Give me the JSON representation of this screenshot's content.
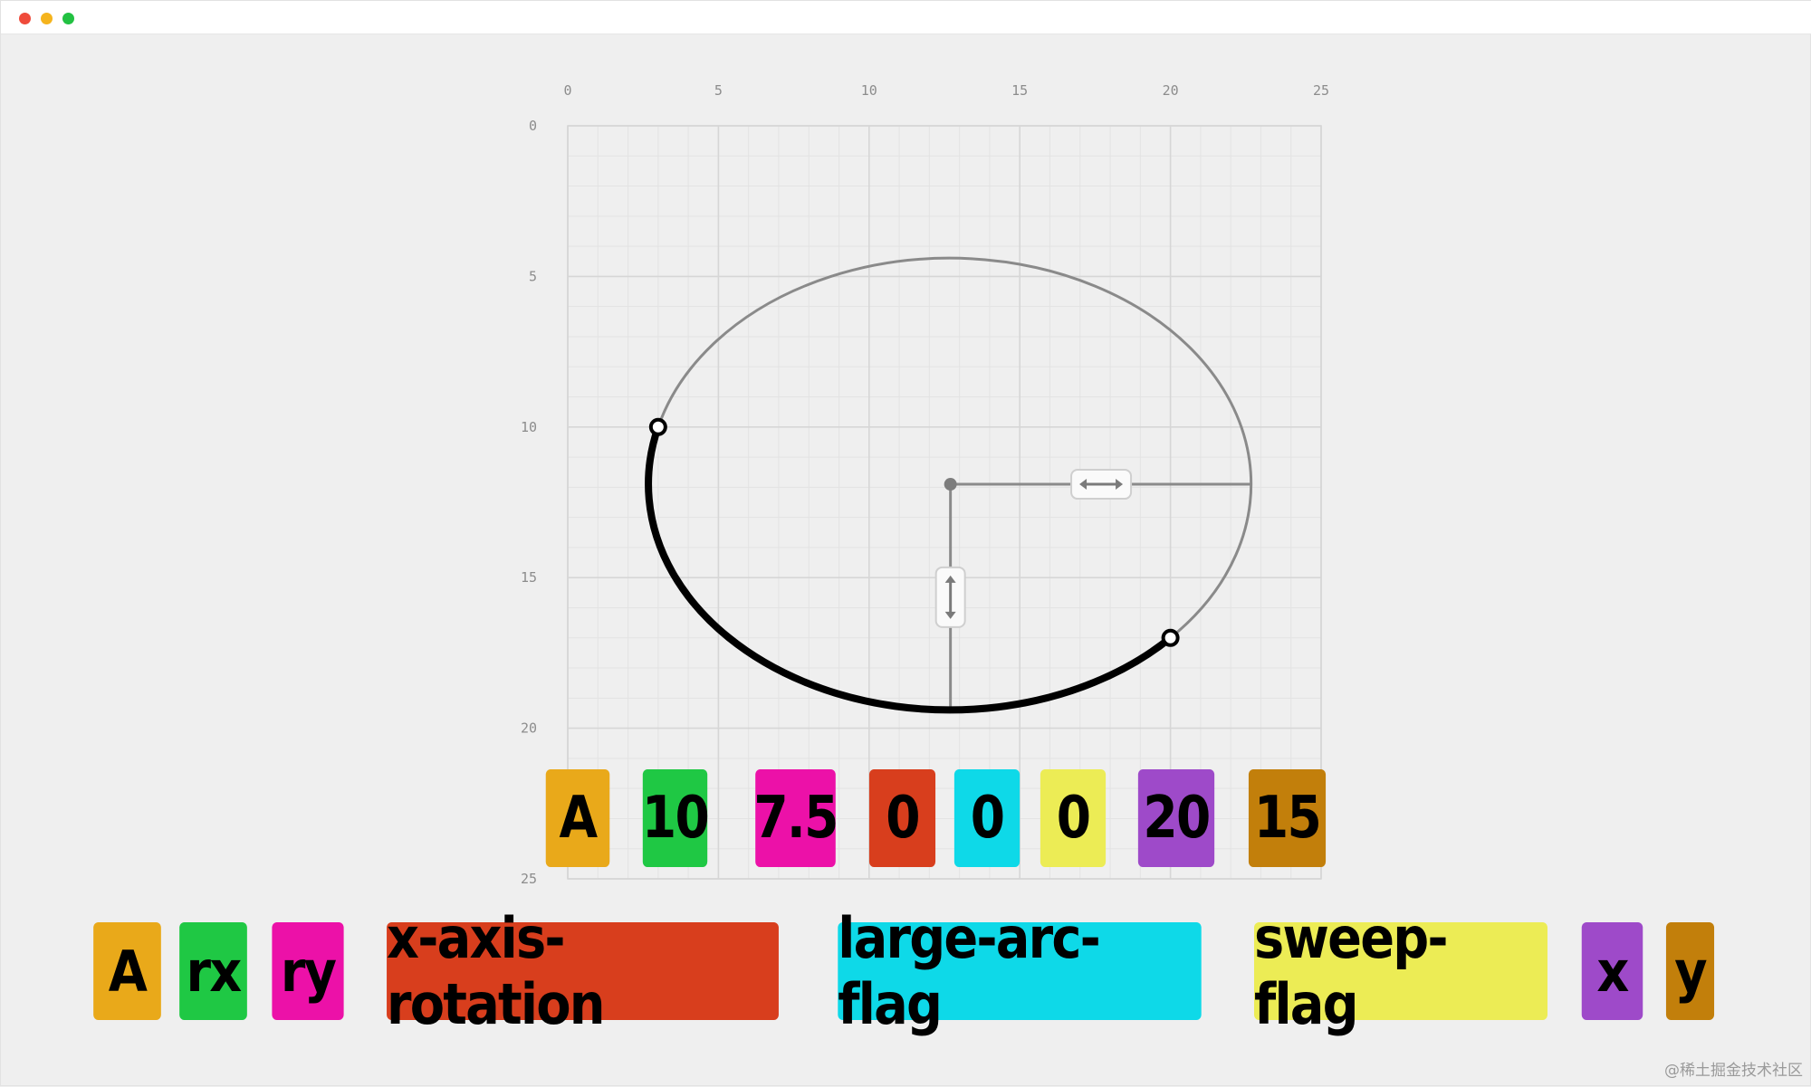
{
  "window": {
    "controls": [
      "close",
      "minimize",
      "maximize"
    ]
  },
  "grid": {
    "x_ticks": [
      "0",
      "5",
      "10",
      "15",
      "20",
      "25"
    ],
    "y_ticks": [
      "0",
      "5",
      "10",
      "15",
      "20",
      "25"
    ]
  },
  "arc": {
    "start": {
      "x": 3,
      "y": 10
    },
    "end": {
      "x": 20,
      "y": 17
    },
    "center": {
      "x": 12.7,
      "y": 11.9
    },
    "rx": 10,
    "ry": 7.5
  },
  "command": [
    {
      "text": "A",
      "color": "#e9a91a"
    },
    {
      "text": "10",
      "color": "#1fc844"
    },
    {
      "text": "7.5",
      "color": "#ec11a8"
    },
    {
      "text": "0",
      "color": "#d83e1d"
    },
    {
      "text": "0",
      "color": "#0ed9e8"
    },
    {
      "text": "0",
      "color": "#ecec55"
    },
    {
      "text": "20",
      "color": "#9e4ac9"
    },
    {
      "text": "15",
      "color": "#c27f0b"
    }
  ],
  "legend": [
    {
      "text": "A",
      "color": "#e9a91a"
    },
    {
      "text": "rx",
      "color": "#1fc844"
    },
    {
      "text": "ry",
      "color": "#ec11a8"
    },
    {
      "text": "x-axis-rotation",
      "color": "#d83e1d"
    },
    {
      "text": "large-arc-flag",
      "color": "#0ed9e8"
    },
    {
      "text": "sweep-flag",
      "color": "#ecec55"
    },
    {
      "text": "x",
      "color": "#9e4ac9"
    },
    {
      "text": "y",
      "color": "#c27f0b"
    }
  ],
  "watermark": "@稀土掘金技术社区"
}
